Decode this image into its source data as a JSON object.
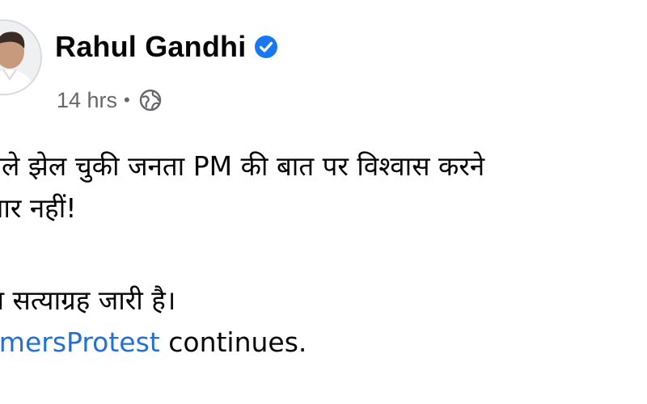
{
  "post": {
    "author": {
      "name": "Rahul Gandhi",
      "verified_icon": "verified-badge-icon",
      "avatar": "profile-avatar"
    },
    "meta": {
      "time": "14 hrs",
      "separator": "•",
      "audience_icon": "globe-icon"
    },
    "body": {
      "line1": "के जुमले झेल चुकी जनता PM की बात पर विश्वास करने",
      "line2": "को तैयार नहीं!",
      "line3": "किसान सत्याग्रह जारी है।",
      "line4_hashtag": "#FarmersProtest",
      "line4_rest": " continues."
    },
    "colors": {
      "verified_blue": "#1877f2",
      "link_blue": "#216fdb",
      "meta_gray": "#65676b",
      "text": "#050505"
    }
  }
}
